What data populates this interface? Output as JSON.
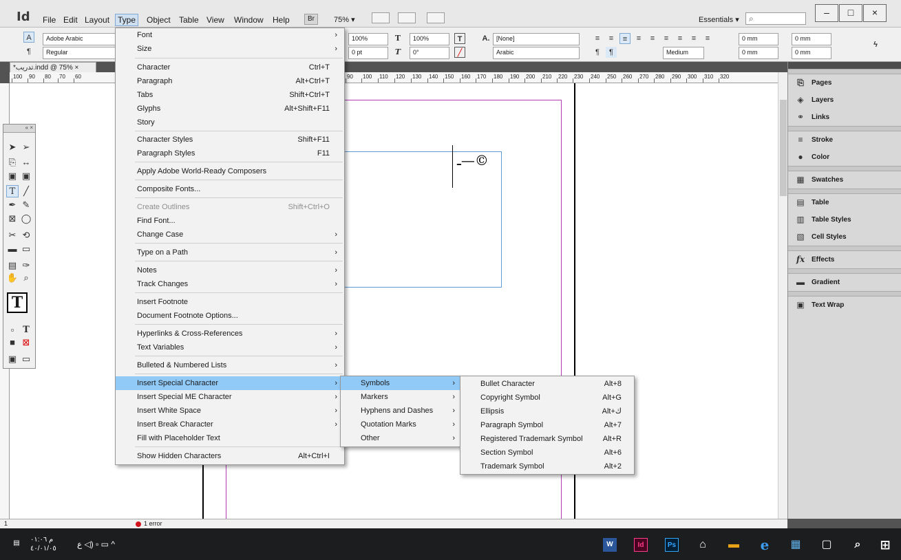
{
  "app": {
    "logo": "Id",
    "zoom": "75% ▾",
    "badge": "Br",
    "workspace": "Essentials ▾",
    "search_icon": "search-icon"
  },
  "menubar": [
    {
      "label": "File"
    },
    {
      "label": "Edit"
    },
    {
      "label": "Layout"
    },
    {
      "label": "Type"
    },
    {
      "label": "Object"
    },
    {
      "label": "Table"
    },
    {
      "label": "View"
    },
    {
      "label": "Window"
    },
    {
      "label": "Help"
    }
  ],
  "window_controls": {
    "minimize": "–",
    "maximize": "□",
    "close": "×"
  },
  "control_panel": {
    "font_family": "Adobe Arabic",
    "font_style": "Regular",
    "vertical_scale": "100%",
    "horizontal_scale": "100%",
    "baseline_shift": "0 pt",
    "skew": "0°",
    "char_style": "[None]",
    "language": "Arabic",
    "weight": "Medium",
    "indent1": "0 mm",
    "indent2": "0 mm",
    "indent3": "0 mm",
    "indent4": "0 mm",
    "char_style_icon": "A."
  },
  "document": {
    "tab_title": "تدريب.indd @ 75% ×",
    "tab_modified_marker": "*",
    "frame_text": "ـ—©",
    "page_number": "1",
    "error_text": "1 error",
    "ruler_top": [
      "100",
      "90",
      "80",
      "70",
      "60",
      "80",
      "90",
      "100",
      "110",
      "120",
      "130",
      "140",
      "150",
      "160",
      "170",
      "180",
      "190",
      "200",
      "210",
      "220",
      "230",
      "240",
      "250",
      "260",
      "270",
      "280",
      "290",
      "300",
      "310",
      "320"
    ]
  },
  "right_dock": [
    {
      "label": "Pages",
      "icon": "pages-icon",
      "glyph": "⎘"
    },
    {
      "label": "Layers",
      "icon": "layers-icon",
      "glyph": "◈"
    },
    {
      "label": "Links",
      "icon": "links-icon",
      "glyph": "⚭"
    },
    {
      "label": "Stroke",
      "icon": "stroke-icon",
      "glyph": "≡"
    },
    {
      "label": "Color",
      "icon": "color-icon",
      "glyph": "●"
    },
    {
      "label": "Swatches",
      "icon": "swatches-icon",
      "glyph": "▦"
    },
    {
      "label": "Table",
      "icon": "table-icon",
      "glyph": "▤"
    },
    {
      "label": "Table Styles",
      "icon": "table-styles-icon",
      "glyph": "▥"
    },
    {
      "label": "Cell Styles",
      "icon": "cell-styles-icon",
      "glyph": "▧"
    },
    {
      "label": "Effects",
      "icon": "effects-icon",
      "glyph": "fx"
    },
    {
      "label": "Gradient",
      "icon": "gradient-icon",
      "glyph": "▬"
    },
    {
      "label": "Text Wrap",
      "icon": "text-wrap-icon",
      "glyph": "▣"
    }
  ],
  "type_menu": [
    {
      "label": "Font",
      "shortcut": "",
      "submenu": true
    },
    {
      "label": "Size",
      "shortcut": "",
      "submenu": true
    },
    {
      "label": "Character",
      "shortcut": "Ctrl+T",
      "submenu": false
    },
    {
      "label": "Paragraph",
      "shortcut": "Alt+Ctrl+T",
      "submenu": false
    },
    {
      "label": "Tabs",
      "shortcut": "Shift+Ctrl+T",
      "submenu": false
    },
    {
      "label": "Glyphs",
      "shortcut": "Alt+Shift+F11",
      "submenu": false
    },
    {
      "label": "Story",
      "shortcut": "",
      "submenu": false
    },
    {
      "label": "Character Styles",
      "shortcut": "Shift+F11",
      "submenu": false
    },
    {
      "label": "Paragraph Styles",
      "shortcut": "F11",
      "submenu": false
    },
    {
      "label": "Apply Adobe World-Ready Composers",
      "shortcut": "",
      "submenu": false
    },
    {
      "label": "Composite Fonts...",
      "shortcut": "",
      "submenu": false
    },
    {
      "label": "Create Outlines",
      "shortcut": "Shift+Ctrl+O",
      "submenu": false,
      "disabled": true
    },
    {
      "label": "Find Font...",
      "shortcut": "",
      "submenu": false
    },
    {
      "label": "Change Case",
      "shortcut": "",
      "submenu": true
    },
    {
      "label": "Type on a Path",
      "shortcut": "",
      "submenu": true
    },
    {
      "label": "Notes",
      "shortcut": "",
      "submenu": true
    },
    {
      "label": "Track Changes",
      "shortcut": "",
      "submenu": true
    },
    {
      "label": "Insert Footnote",
      "shortcut": "",
      "submenu": false
    },
    {
      "label": "Document Footnote Options...",
      "shortcut": "",
      "submenu": false
    },
    {
      "label": "Hyperlinks & Cross-References",
      "shortcut": "",
      "submenu": true
    },
    {
      "label": "Text Variables",
      "shortcut": "",
      "submenu": true
    },
    {
      "label": "Bulleted & Numbered Lists",
      "shortcut": "",
      "submenu": true
    },
    {
      "label": "Insert Special Character",
      "shortcut": "",
      "submenu": true,
      "highlight": true
    },
    {
      "label": "Insert Special ME Character",
      "shortcut": "",
      "submenu": true
    },
    {
      "label": "Insert White Space",
      "shortcut": "",
      "submenu": true
    },
    {
      "label": "Insert Break Character",
      "shortcut": "",
      "submenu": true
    },
    {
      "label": "Fill with Placeholder Text",
      "shortcut": "",
      "submenu": false
    },
    {
      "label": "Show Hidden Characters",
      "shortcut": "Alt+Ctrl+I",
      "submenu": false
    }
  ],
  "special_submenu": [
    {
      "label": "Symbols",
      "highlight": true
    },
    {
      "label": "Markers"
    },
    {
      "label": "Hyphens and Dashes"
    },
    {
      "label": "Quotation Marks"
    },
    {
      "label": "Other"
    }
  ],
  "symbols_submenu": [
    {
      "label": "Bullet Character",
      "shortcut": "Alt+8"
    },
    {
      "label": "Copyright Symbol",
      "shortcut": "Alt+G"
    },
    {
      "label": "Ellipsis",
      "shortcut": "Alt+ك"
    },
    {
      "label": "Paragraph Symbol",
      "shortcut": "Alt+7"
    },
    {
      "label": "Registered Trademark Symbol",
      "shortcut": "Alt+R"
    },
    {
      "label": "Section Symbol",
      "shortcut": "Alt+6"
    },
    {
      "label": "Trademark Symbol",
      "shortcut": "Alt+2"
    }
  ],
  "taskbar": {
    "clock_time": "م ٠١:٠٦",
    "clock_date": "٤٠/٠١/٠٥",
    "tray_text": "ع ◁) ▫ ▭ ^",
    "apps": [
      {
        "label": "W",
        "color": "#2b579a",
        "name": "word-icon"
      },
      {
        "label": "Id",
        "color": "#49021f",
        "name": "indesign-icon"
      },
      {
        "label": "Ps",
        "color": "#001e36",
        "name": "photoshop-icon"
      },
      {
        "label": "⌂",
        "color": "#1c1d1f",
        "name": "store-icon"
      },
      {
        "label": "▬",
        "color": "#e8a317",
        "name": "explorer-icon"
      },
      {
        "label": "e",
        "color": "#1c1d1f",
        "name": "edge-icon"
      },
      {
        "label": "▦",
        "color": "#1c1d1f",
        "name": "app-icon"
      },
      {
        "label": "▢",
        "color": "#1c1d1f",
        "name": "task-view-icon"
      },
      {
        "label": "⌕",
        "color": "#1c1d1f",
        "name": "search-taskbar-icon"
      },
      {
        "label": "⊞",
        "color": "#1c1d1f",
        "name": "start-icon"
      }
    ]
  }
}
